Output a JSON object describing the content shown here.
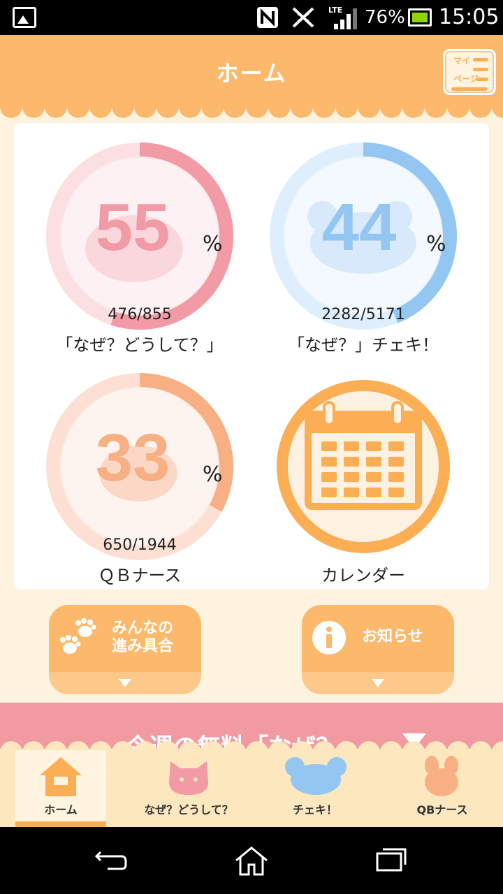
{
  "status_bar": {
    "battery_percent": "76%",
    "time": "15:05",
    "network": "LTE",
    "battery_color": "#8fd400"
  },
  "header": {
    "title": "ホーム",
    "mypage_line1": "マイ",
    "mypage_line2": "ページ",
    "background": "#fcb96b"
  },
  "tiles": [
    {
      "percent": "55",
      "percent_value": 55,
      "unit": "%",
      "count": "476/855",
      "label": "「なぜ？どうして？」",
      "color": "#f39aa7",
      "track": "#fbdfe3",
      "icon": "cat-icon"
    },
    {
      "percent": "44",
      "percent_value": 44,
      "unit": "%",
      "count": "2282/5171",
      "label": "「なぜ？」チェキ！",
      "color": "#93c6f1",
      "track": "#dfeefc",
      "icon": "cloud-character-icon"
    },
    {
      "percent": "33",
      "percent_value": 33,
      "unit": "%",
      "count": "650/1944",
      "label": "ＱＢナース",
      "color": "#f7af83",
      "track": "#fde0d3",
      "icon": "rabbit-icon"
    },
    {
      "label": "カレンダー",
      "color": "#fcae55",
      "icon": "calendar-icon"
    }
  ],
  "buttons": {
    "progress_line1": "みんなの",
    "progress_line2": "進み具合",
    "news": "お知らせ"
  },
  "banner": {
    "text": "今週の無料「なぜ？」",
    "color": "#f19aa2"
  },
  "tabs": [
    {
      "label": "ホーム",
      "icon": "home-icon"
    },
    {
      "label": "なぜ？どうして？",
      "icon": "cat-icon"
    },
    {
      "label": "チェキ！",
      "icon": "cloud-character-icon"
    },
    {
      "label": "QBナース",
      "icon": "rabbit-icon"
    }
  ]
}
